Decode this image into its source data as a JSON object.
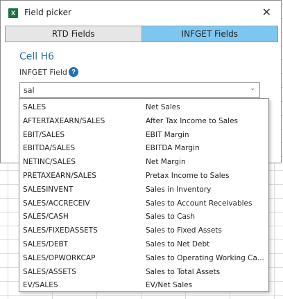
{
  "window": {
    "title": "Field picker",
    "close_glyph": "✕"
  },
  "tabs": [
    {
      "label": "RTD Fields",
      "active": false
    },
    {
      "label": "INFGET Fields",
      "active": true
    }
  ],
  "cell_label": "Cell H6",
  "field_label": "INFGET Field",
  "help_glyph": "?",
  "search": {
    "value": "sal",
    "arrow_glyph": "⌄"
  },
  "options": [
    {
      "code": "SALES",
      "description": "Net Sales"
    },
    {
      "code": "AFTERTAXEARN/SALES",
      "description": "After Tax Income to Sales"
    },
    {
      "code": "EBIT/SALES",
      "description": "EBIT Margin"
    },
    {
      "code": "EBITDA/SALES",
      "description": "EBITDA Margin"
    },
    {
      "code": "NETINC/SALES",
      "description": "Net Margin"
    },
    {
      "code": "PRETAXEARN/SALES",
      "description": "Pretax Income to Sales"
    },
    {
      "code": "SALESINVENT",
      "description": "Sales in Inventory"
    },
    {
      "code": "SALES/ACCRECEIV",
      "description": "Sales to Account Receivables"
    },
    {
      "code": "SALES/CASH",
      "description": "Sales to Cash"
    },
    {
      "code": "SALES/FIXEDASSETS",
      "description": "Sales to Fixed Assets"
    },
    {
      "code": "SALES/DEBT",
      "description": "Sales to Net Debt"
    },
    {
      "code": "SALES/OPWORKCAP",
      "description": "Sales to Operating Working Ca..."
    },
    {
      "code": "SALES/ASSETS",
      "description": "Sales to Total Assets"
    },
    {
      "code": "EV/SALES",
      "description": "EV/Net Sales"
    }
  ],
  "colors": {
    "active_tab": "#7dc6ef",
    "accent": "#2e6da4",
    "excel": "#1d7044"
  },
  "icons": {
    "app": "excel-icon",
    "help": "help-icon",
    "close": "close-icon"
  }
}
